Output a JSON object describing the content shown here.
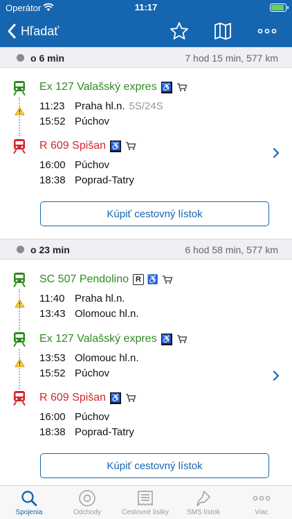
{
  "status_bar": {
    "carrier": "Operátor",
    "time": "11:17"
  },
  "nav": {
    "back_label": "Hľadať"
  },
  "connections": [
    {
      "departs_in": "o 6 min",
      "duration": "7 hod 15 min, 577 km",
      "legs": [
        {
          "train": "Ex 127 Valašský expres",
          "color": "#2e8b1f",
          "stops": [
            {
              "time": "11:23",
              "station": "Praha hl.n.",
              "platform": "5S/24S"
            },
            {
              "time": "15:52",
              "station": "Púchov"
            }
          ]
        },
        {
          "train": "R 609 Spišan",
          "color": "#d4262c",
          "stops": [
            {
              "time": "16:00",
              "station": "Púchov"
            },
            {
              "time": "18:38",
              "station": "Poprad-Tatry"
            }
          ]
        }
      ],
      "buy_label": "Kúpiť cestovný lístok"
    },
    {
      "departs_in": "o 23 min",
      "duration": "6 hod 58 min, 577 km",
      "legs": [
        {
          "train": "SC 507 Pendolino",
          "color": "#2e8b1f",
          "stops": [
            {
              "time": "11:40",
              "station": "Praha hl.n."
            },
            {
              "time": "13:43",
              "station": "Olomouc hl.n."
            }
          ]
        },
        {
          "train": "Ex 127 Valašský expres",
          "color": "#2e8b1f",
          "stops": [
            {
              "time": "13:53",
              "station": "Olomouc hl.n."
            },
            {
              "time": "15:52",
              "station": "Púchov"
            }
          ]
        },
        {
          "train": "R 609 Spišan",
          "color": "#d4262c",
          "stops": [
            {
              "time": "16:00",
              "station": "Púchov"
            },
            {
              "time": "18:38",
              "station": "Poprad-Tatry"
            }
          ]
        }
      ],
      "buy_label": "Kúpiť cestovný lístok"
    }
  ],
  "tabs": [
    {
      "label": "Spojenia",
      "icon": "search-icon",
      "active": true
    },
    {
      "label": "Odchody",
      "icon": "clock-icon"
    },
    {
      "label": "Cestovné lístky",
      "icon": "ticket-icon"
    },
    {
      "label": "SMS lístok",
      "icon": "sms-icon"
    },
    {
      "label": "Viac",
      "icon": "more-icon"
    }
  ],
  "colors": {
    "brand": "#1565b0",
    "green": "#2e8b1f",
    "red": "#d4262c"
  }
}
